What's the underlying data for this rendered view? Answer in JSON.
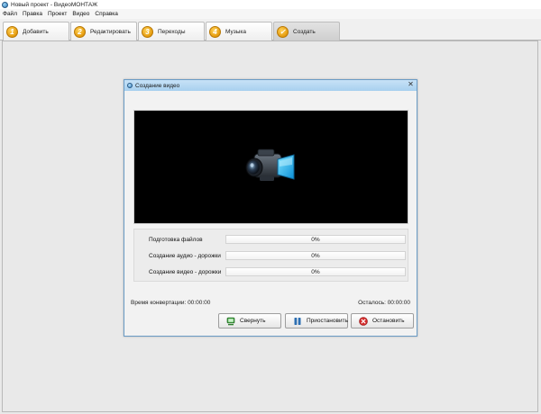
{
  "window": {
    "title": "Новый проект - ВидеоМОНТАЖ"
  },
  "menu": {
    "items": [
      "Файл",
      "Правка",
      "Проект",
      "Видео",
      "Справка"
    ]
  },
  "tabs": [
    {
      "num": "1",
      "label": "Добавить",
      "active": false
    },
    {
      "num": "2",
      "label": "Редактировать",
      "active": false
    },
    {
      "num": "3",
      "label": "Переходы",
      "active": false
    },
    {
      "num": "4",
      "label": "Музыка",
      "active": false
    },
    {
      "num": "✓",
      "label": "Создать",
      "active": true
    }
  ],
  "dialog": {
    "title": "Создание видео",
    "close_glyph": "✕",
    "progress": [
      {
        "label": "Подготовка файлов",
        "value_text": "0%",
        "value": 0
      },
      {
        "label": "Создание аудио - дорожки",
        "value_text": "0%",
        "value": 0
      },
      {
        "label": "Создание видео - дорожки",
        "value_text": "0%",
        "value": 0
      }
    ],
    "conversion_time": "Время конвертации: 00:00:00",
    "remaining": "Осталось: 00:00:00",
    "buttons": {
      "minimize": "Свернуть",
      "pause": "Приостановить",
      "stop": "Остановить"
    }
  },
  "colors": {
    "accent_tab": "#e59b0d",
    "progress_fill": "#7fbf4d",
    "stop_icon": "#d32a2a",
    "pause_icon": "#2d6fb2",
    "minimize_icon": "#3a9a3a"
  }
}
